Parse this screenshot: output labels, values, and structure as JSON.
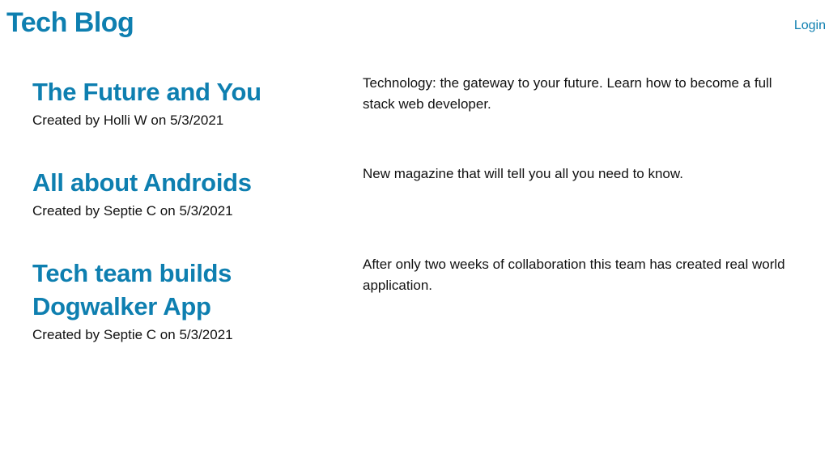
{
  "header": {
    "title": "Tech Blog",
    "login_label": "Login"
  },
  "posts": [
    {
      "title": "The Future and You",
      "meta": "Created by Holli W on 5/3/2021",
      "body": "Technology: the gateway to your future. Learn how to become a full stack web developer."
    },
    {
      "title": "All about Androids",
      "meta": "Created by Septie C on 5/3/2021",
      "body": "New magazine that will tell you all you need to know."
    },
    {
      "title": "Tech team builds Dogwalker App",
      "meta": "Created by Septie C on 5/3/2021",
      "body": "After only two weeks of collaboration this team has created real world application."
    }
  ],
  "colors": {
    "accent": "#0e7fb0",
    "text": "#111111",
    "background": "#ffffff"
  }
}
